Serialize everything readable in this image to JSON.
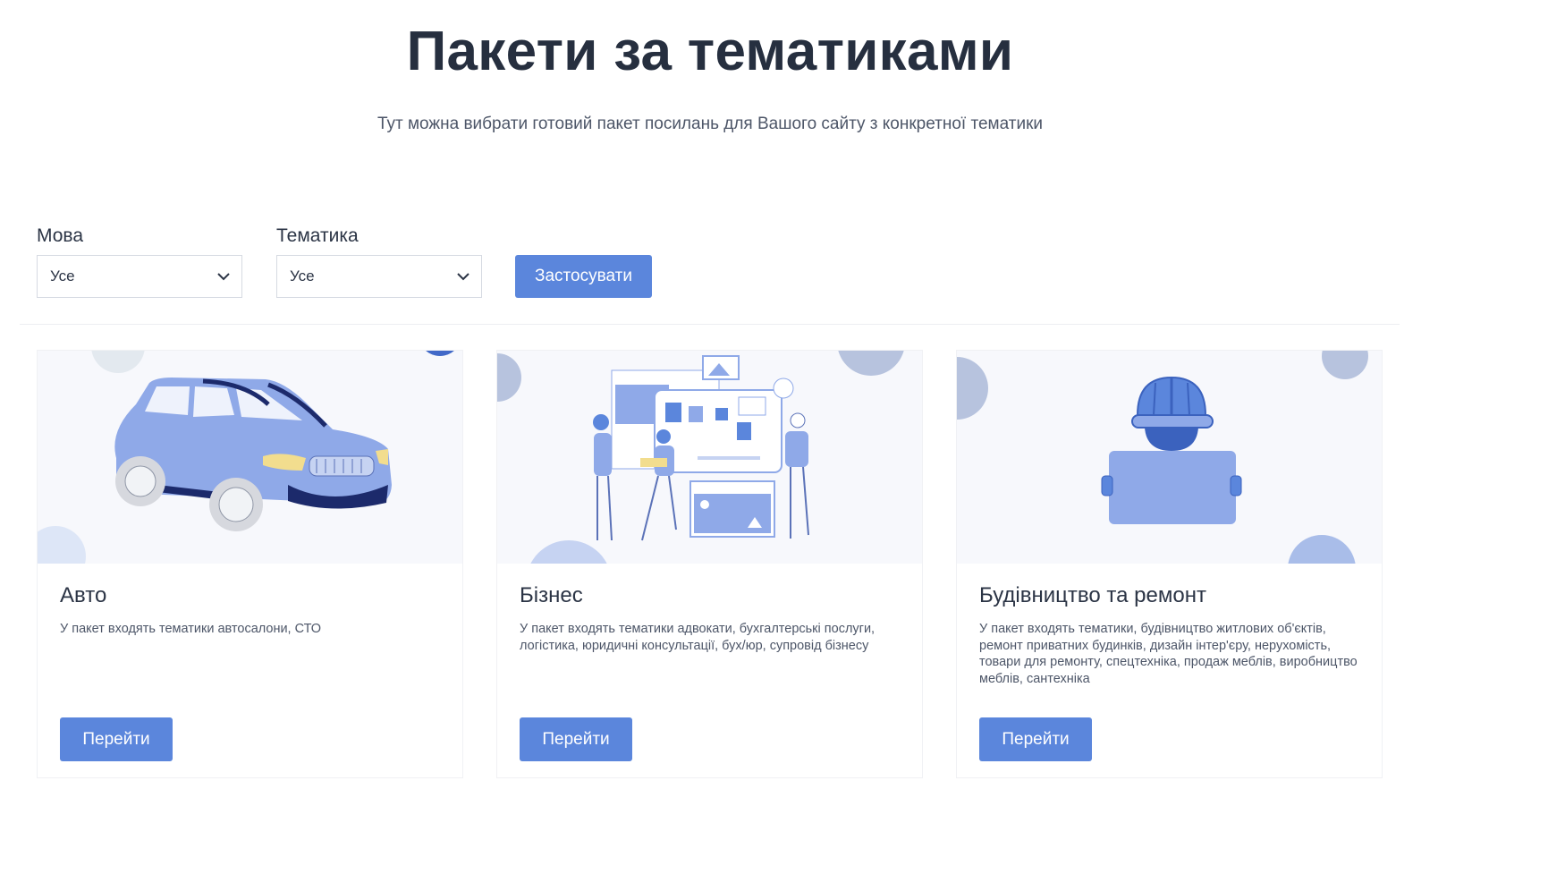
{
  "header": {
    "title": "Пакети за тематиками",
    "subtitle": "Тут можна вибрати готовий пакет посилань для Вашого сайту з конкретної тематики"
  },
  "filters": {
    "language": {
      "label": "Мова",
      "value": "Усе"
    },
    "topic": {
      "label": "Тематика",
      "value": "Усе"
    },
    "apply_label": "Застосувати"
  },
  "cards": [
    {
      "title": "Авто",
      "description": "У пакет входять тематики автосалони, СТО",
      "button_label": "Перейти",
      "illustration": "car-illustration"
    },
    {
      "title": "Бізнес",
      "description": "У пакет входять тематики адвокати, бухгалтерські послуги, логістика, юридичні консультації, бух/юр, супровід бізнесу",
      "button_label": "Перейти",
      "illustration": "business-team-illustration"
    },
    {
      "title": "Будівництво та ремонт",
      "description": "У пакет входять тематики, будівництво житлових об'єктів, ремонт приватних будинків, дизайн інтер'єру, нерухомість, товари для ремонту, спецтехніка, продаж меблів, виробництво меблів, сантехніка",
      "button_label": "Перейти",
      "illustration": "builder-helmet-illustration"
    }
  ],
  "colors": {
    "accent": "#5b86dc",
    "title": "#262f3f",
    "illustration_blue": "#8fa9e8",
    "illustration_navy": "#1c2a6b",
    "illustration_bg": "#f7f8fc"
  }
}
